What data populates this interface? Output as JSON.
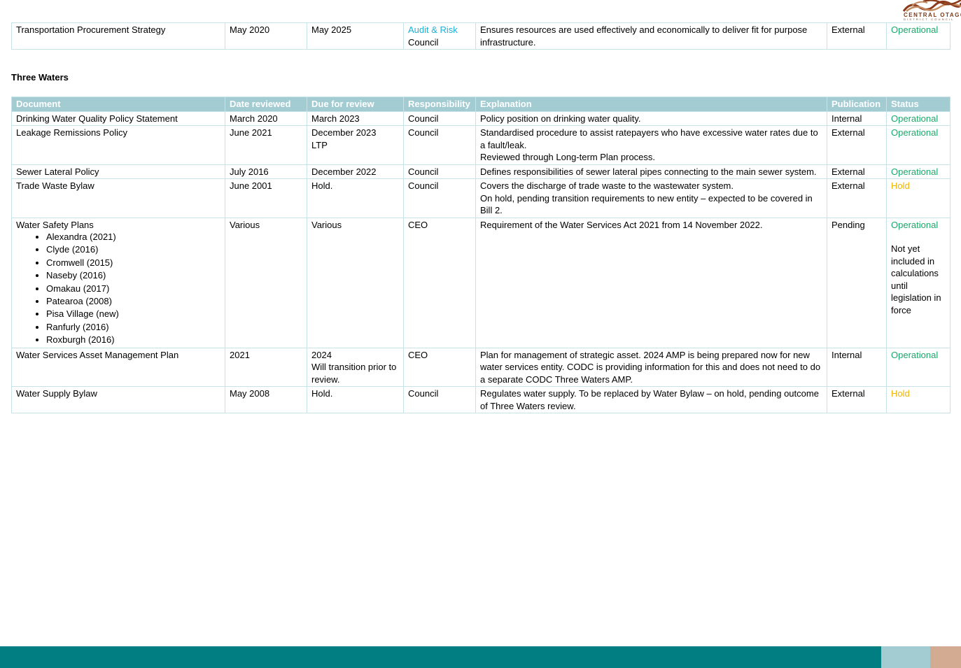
{
  "logo": {
    "name": "CENTRAL OTAGO",
    "subtitle": "DISTRICT COUNCIL",
    "colors": [
      "#8b3a1a",
      "#c28a5e",
      "#7a3a1a"
    ]
  },
  "top_row": {
    "document": "Transportation Procurement Strategy",
    "date_reviewed": "May 2020",
    "due_for_review": "May 2025",
    "responsibility_link": "Audit & Risk",
    "responsibility": "Council",
    "explanation": "Ensures resources are used effectively and economically to deliver fit for purpose infrastructure.",
    "publication": "External",
    "status": "Operational"
  },
  "section_title": "Three Waters",
  "headers": {
    "document": "Document",
    "date_reviewed": "Date reviewed",
    "due_for_review": "Due for review",
    "responsibility": "Responsibility",
    "explanation": "Explanation",
    "publication": "Publication",
    "status": "Status"
  },
  "rows": [
    {
      "document": "Drinking Water Quality Policy Statement",
      "date_reviewed": "March 2020",
      "due_for_review": "March 2023",
      "responsibility": "Council",
      "explanation": "Policy position on drinking water quality.",
      "publication": "Internal",
      "status": "Operational"
    },
    {
      "document": "Leakage Remissions Policy",
      "date_reviewed": "June 2021",
      "due_for_review": "December 2023",
      "due_for_review_2": "LTP",
      "responsibility": "Council",
      "explanation": "Standardised procedure to assist ratepayers who have excessive water rates due to a fault/leak.",
      "explanation_2": "Reviewed through Long-term Plan process.",
      "publication": "External",
      "status": "Operational"
    },
    {
      "document": "Sewer Lateral Policy",
      "date_reviewed": "July 2016",
      "due_for_review": "December 2022",
      "responsibility": "Council",
      "explanation": "Defines responsibilities of sewer lateral pipes connecting to the main sewer system.",
      "publication": "External",
      "status": "Operational"
    },
    {
      "document": "Trade Waste Bylaw",
      "date_reviewed": "June 2001",
      "due_for_review": "Hold.",
      "responsibility": "Council",
      "explanation": "Covers the discharge of trade waste to the wastewater system.",
      "explanation_2": "On hold, pending transition requirements to new entity – expected to be covered in Bill 2.",
      "publication": "External",
      "status": "Hold"
    },
    {
      "document": "Water Safety Plans",
      "plans": [
        "Alexandra (2021)",
        "Clyde (2016)",
        "Cromwell (2015)",
        "Naseby (2016)",
        "Omakau (2017)",
        "Patearoa (2008)",
        "Pisa Village (new)",
        "Ranfurly (2016)",
        "Roxburgh (2016)"
      ],
      "date_reviewed": "Various",
      "due_for_review": "Various",
      "responsibility": "CEO",
      "explanation": "Requirement of the Water Services Act 2021 from 14 November 2022.",
      "publication": "Pending",
      "status": "Operational",
      "status_note": "Not yet included in calculations until legislation in force"
    },
    {
      "document": "Water Services Asset Management Plan",
      "date_reviewed": "2021",
      "due_for_review": "2024",
      "due_for_review_2": "Will transition prior to review.",
      "responsibility": "CEO",
      "explanation": "Plan for management of strategic asset. 2024 AMP is being prepared now for new water services entity. CODC is providing information for this and does not need to do a separate CODC Three Waters AMP.",
      "publication": "Internal",
      "status": "Operational"
    },
    {
      "document": "Water Supply Bylaw",
      "date_reviewed": "May 2008",
      "due_for_review": "Hold.",
      "responsibility": "Council",
      "explanation": "Regulates water supply. To be replaced by Water Bylaw – on hold, pending outcome of Three Waters review.",
      "publication": "External",
      "status": "Hold"
    }
  ],
  "colors": {
    "header_bg": "#a2cbd2",
    "operational": "#1aa86a",
    "hold": "#f0b400",
    "link": "#1eb0d8",
    "footer_teal": "#007e82",
    "footer_light": "#a2cbd2",
    "footer_tan": "#d3ab93"
  }
}
